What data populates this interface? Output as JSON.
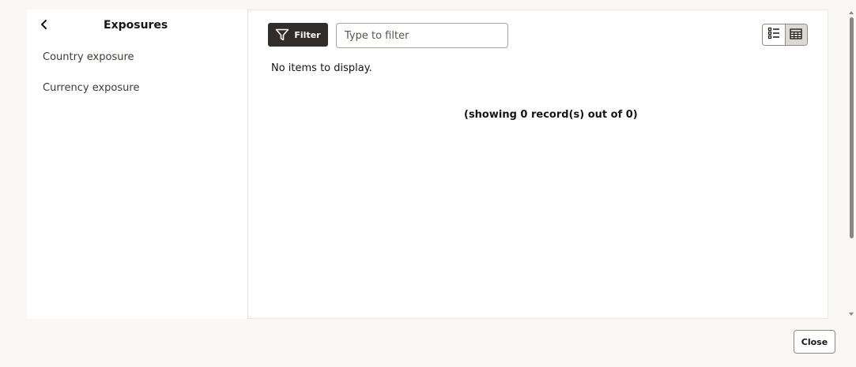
{
  "sidebar": {
    "title": "Exposures",
    "back_icon": "chevron-left-icon",
    "items": [
      {
        "label": "Country exposure"
      },
      {
        "label": "Currency exposure"
      }
    ]
  },
  "toolbar": {
    "filter_label": "Filter",
    "filter_icon": "funnel-icon",
    "filter_placeholder": "Type to filter",
    "filter_value": "",
    "view_modes": [
      {
        "icon": "list-view-icon",
        "selected": false
      },
      {
        "icon": "table-view-icon",
        "selected": true
      }
    ]
  },
  "content": {
    "empty_message": "No items to display.",
    "record_count": "(showing 0 record(s) out of 0)"
  },
  "footer": {
    "close_label": "Close"
  },
  "colors": {
    "page_background": "#f9f8f6",
    "primary_button": "#312d2a",
    "selected_toggle": "#dcd9d5"
  }
}
